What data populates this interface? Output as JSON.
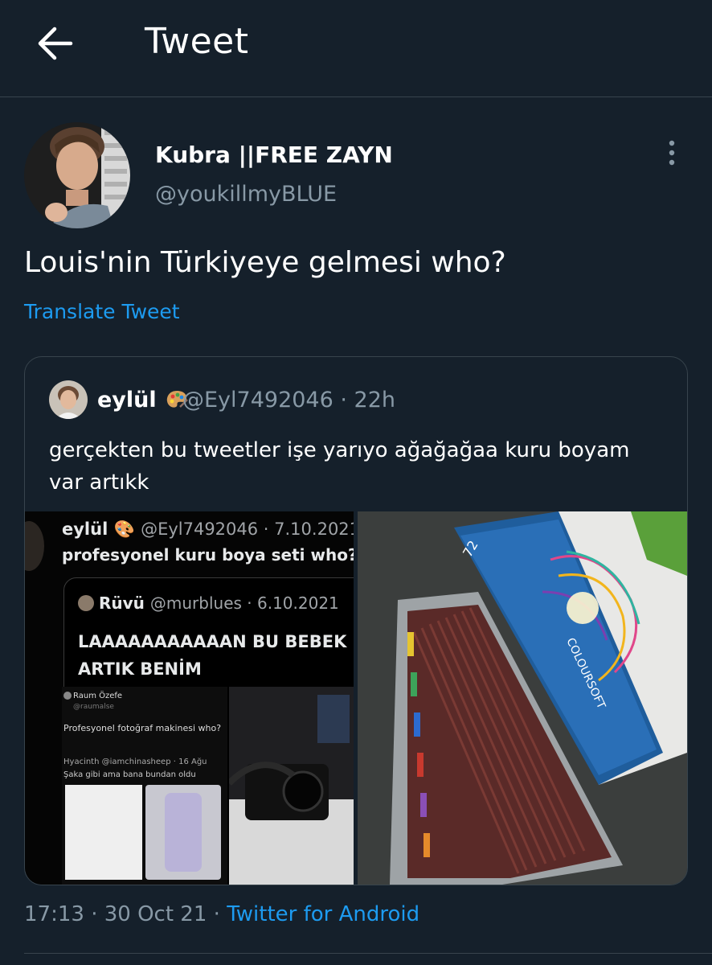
{
  "header": {
    "title": "Tweet",
    "back_icon": "arrow-left-icon"
  },
  "tweet": {
    "author_name": "Kubra ||FREE ZAYN",
    "author_handle": "@youkillmyBLUE",
    "text": "Louis'nin Türkiyeye gelmesi who?",
    "translate_label": "Translate Tweet",
    "more_icon": "vertical-dots-icon",
    "time": "17:13",
    "date": "30 Oct 21",
    "source": "Twitter for Android",
    "separator": "·"
  },
  "quoted": {
    "name": "eylül",
    "handle": "@Eyl7492046",
    "time": "· 22h",
    "text": "gerçekten bu tweetler işe yarıyo ağağağaa kuru boyam var artıkk",
    "media": {
      "left": {
        "name": "eylül",
        "handle_date": "@Eyl7492046 · 7.10.2021",
        "text": "profesyonel kuru boya seti who?",
        "quote_name": "Rüvü",
        "quote_handle_date": "@murblues · 6.10.2021",
        "quote_text_line1": "LAAAAAAAAAAAN BU BEBEK",
        "quote_text_line2": "ARTIK BENİM",
        "inner_name": "Raum Özefe",
        "inner_handle": "@raumalse",
        "inner_text": "Profesyonel fotoğraf makinesi who?",
        "inner_reply": "Hyacinth @iamchinasheep · 16 Ağu",
        "inner_reply_text": "Şaka gibi ama bana bundan oldu"
      },
      "right": {
        "box_label": "72",
        "brand": "COLOURSOFT"
      }
    }
  },
  "colors": {
    "background": "#15202b",
    "accent": "#1d9bf0",
    "muted": "#8899a6",
    "border": "#38444d"
  }
}
